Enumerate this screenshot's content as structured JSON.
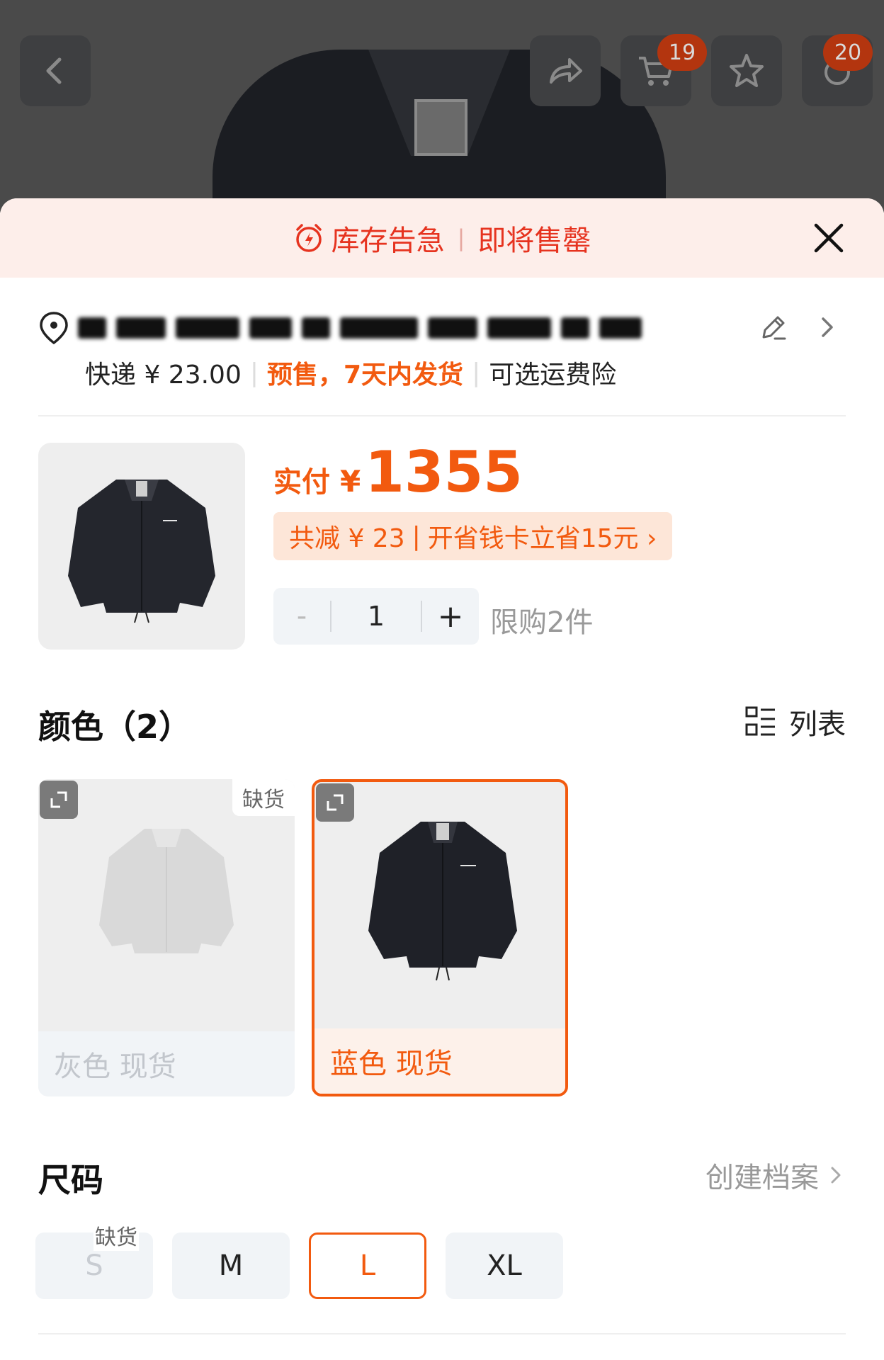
{
  "header": {
    "cart_badge": "19",
    "message_badge": "20"
  },
  "alert": {
    "part1": "库存告急",
    "part2": "即将售罄"
  },
  "shipping": {
    "fee": "快递 ¥ 23.00",
    "presale": "预售，7天内发货",
    "insurance": "可选运费险"
  },
  "product": {
    "price_label": "实付",
    "currency": "¥",
    "price": "1355",
    "promo_discount": "共减 ¥ 23",
    "promo_card": "开省钱卡立省15元 ›",
    "quantity": "1",
    "minus": "-",
    "plus": "+",
    "limit": "限购2件"
  },
  "color_section": {
    "title": "颜色（2）",
    "list_label": "列表",
    "options": [
      {
        "label": "灰色 现货",
        "tag": "缺货",
        "state": "disabled"
      },
      {
        "label": "蓝色 现货",
        "tag": "",
        "state": "selected"
      }
    ]
  },
  "size_section": {
    "title": "尺码",
    "profile_link": "创建档案",
    "oos_tag": "缺货",
    "options": [
      {
        "label": "S",
        "state": "disabled"
      },
      {
        "label": "M",
        "state": "normal"
      },
      {
        "label": "L",
        "state": "selected"
      },
      {
        "label": "XL",
        "state": "normal"
      }
    ]
  },
  "colors": {
    "accent": "#f25a0f",
    "alert_red": "#e6331f",
    "badge": "#b3350f"
  }
}
